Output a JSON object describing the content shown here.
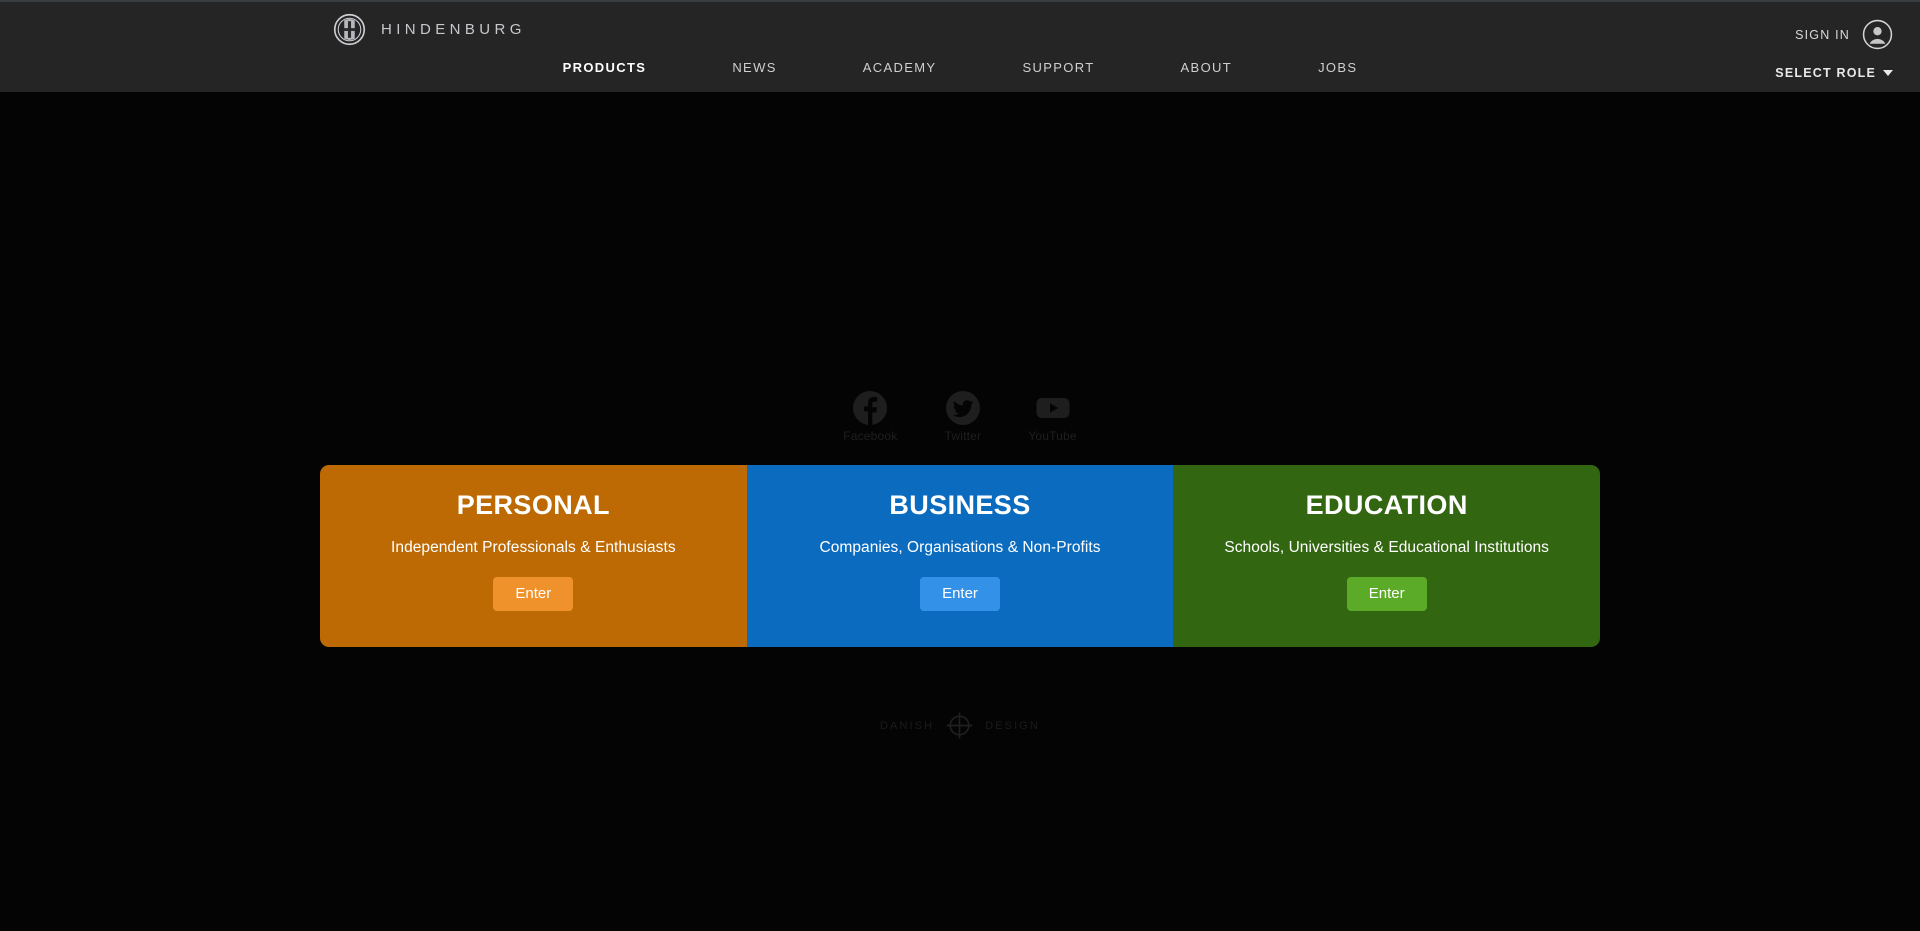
{
  "brand": {
    "name": "HINDENBURG",
    "logo_icon": "hindenburg-circle-h-icon"
  },
  "header": {
    "nav": [
      {
        "label": "PRODUCTS",
        "active": true
      },
      {
        "label": "NEWS",
        "active": false
      },
      {
        "label": "ACADEMY",
        "active": false
      },
      {
        "label": "SUPPORT",
        "active": false
      },
      {
        "label": "ABOUT",
        "active": false
      },
      {
        "label": "JOBS",
        "active": false
      }
    ],
    "sign_in_label": "SIGN IN",
    "avatar_icon": "user-avatar-icon",
    "role_selector_label": "SELECT ROLE",
    "role_selector_icon": "chevron-down-icon",
    "background_color": "#252525"
  },
  "social": [
    {
      "label": "Facebook",
      "icon": "facebook-icon"
    },
    {
      "label": "Twitter",
      "icon": "twitter-icon"
    },
    {
      "label": "YouTube",
      "icon": "youtube-icon"
    }
  ],
  "role_cards": [
    {
      "title": "PERSONAL",
      "subtitle": "Independent Professionals & Enthusiasts",
      "button_label": "Enter",
      "background_color": "#bd6a05",
      "button_color": "#f0922b"
    },
    {
      "title": "BUSINESS",
      "subtitle": "Companies, Organisations & Non-Profits",
      "button_label": "Enter",
      "background_color": "#0b6cbf",
      "button_color": "#3391e8"
    },
    {
      "title": "EDUCATION",
      "subtitle": "Schools, Universities & Educational Institutions",
      "button_label": "Enter",
      "background_color": "#336611",
      "button_color": "#5cab28"
    }
  ],
  "footer_mark": {
    "left_word": "DANISH",
    "right_word": "DESIGN",
    "icon": "danish-design-circle-cross-icon"
  },
  "page_background_color": "#040404"
}
